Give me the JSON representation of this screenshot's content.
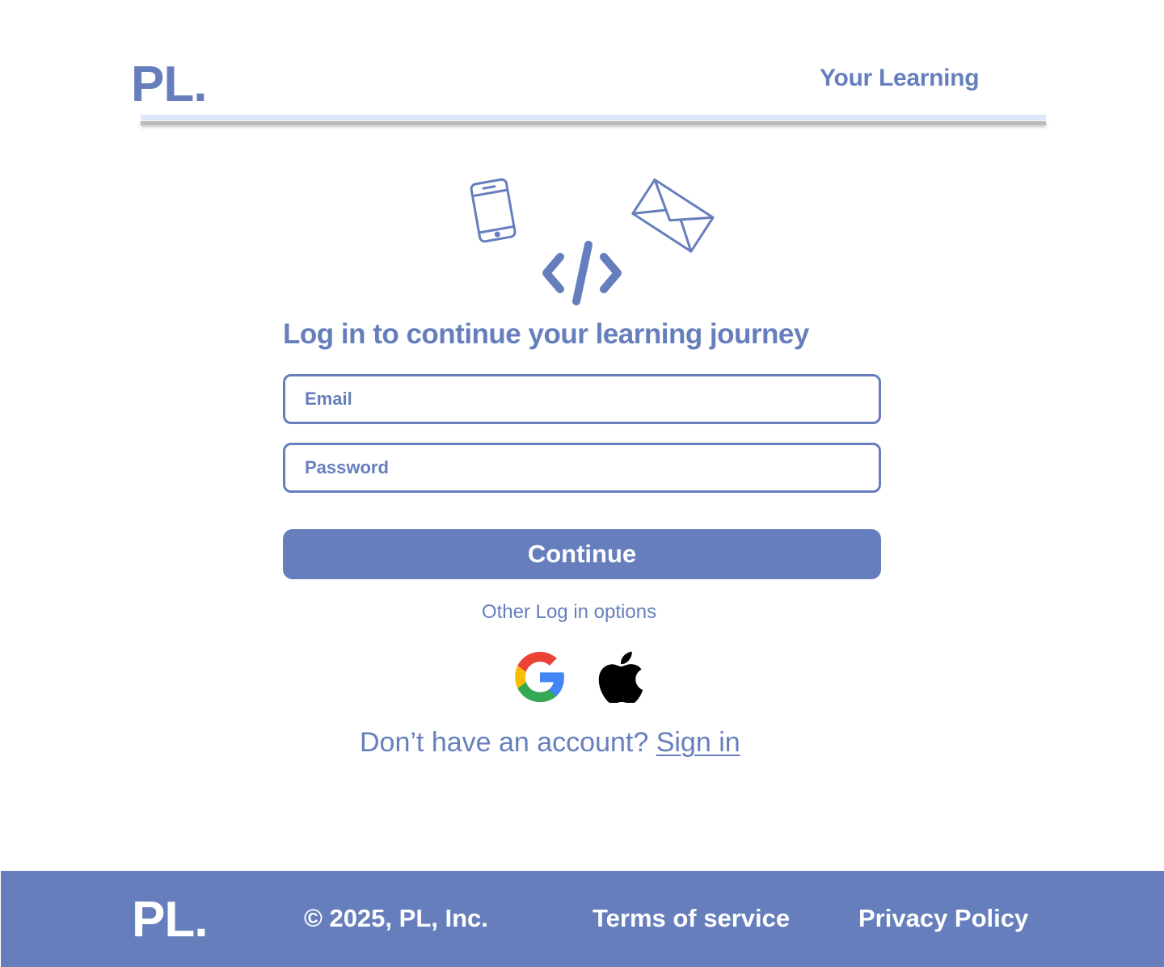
{
  "header": {
    "logo": "PL.",
    "nav_link": "Your Learning"
  },
  "hero": {
    "icons": [
      "phone-icon",
      "envelope-icon",
      "code-icon"
    ],
    "accent_color": "#667fbc"
  },
  "login": {
    "headline": "Log in to continue your learning journey",
    "email_placeholder": "Email",
    "password_placeholder": "Password",
    "continue_label": "Continue",
    "other_options_label": "Other Log in options",
    "providers": [
      "google-icon",
      "apple-icon"
    ],
    "no_account_text": "Don’t have an account?",
    "sign_in_link": "Sign in"
  },
  "footer": {
    "logo": "PL.",
    "copyright": "© 2025, PL, Inc.",
    "terms": "Terms of service",
    "privacy": "Privacy Policy",
    "background_color": "#667fbc"
  }
}
